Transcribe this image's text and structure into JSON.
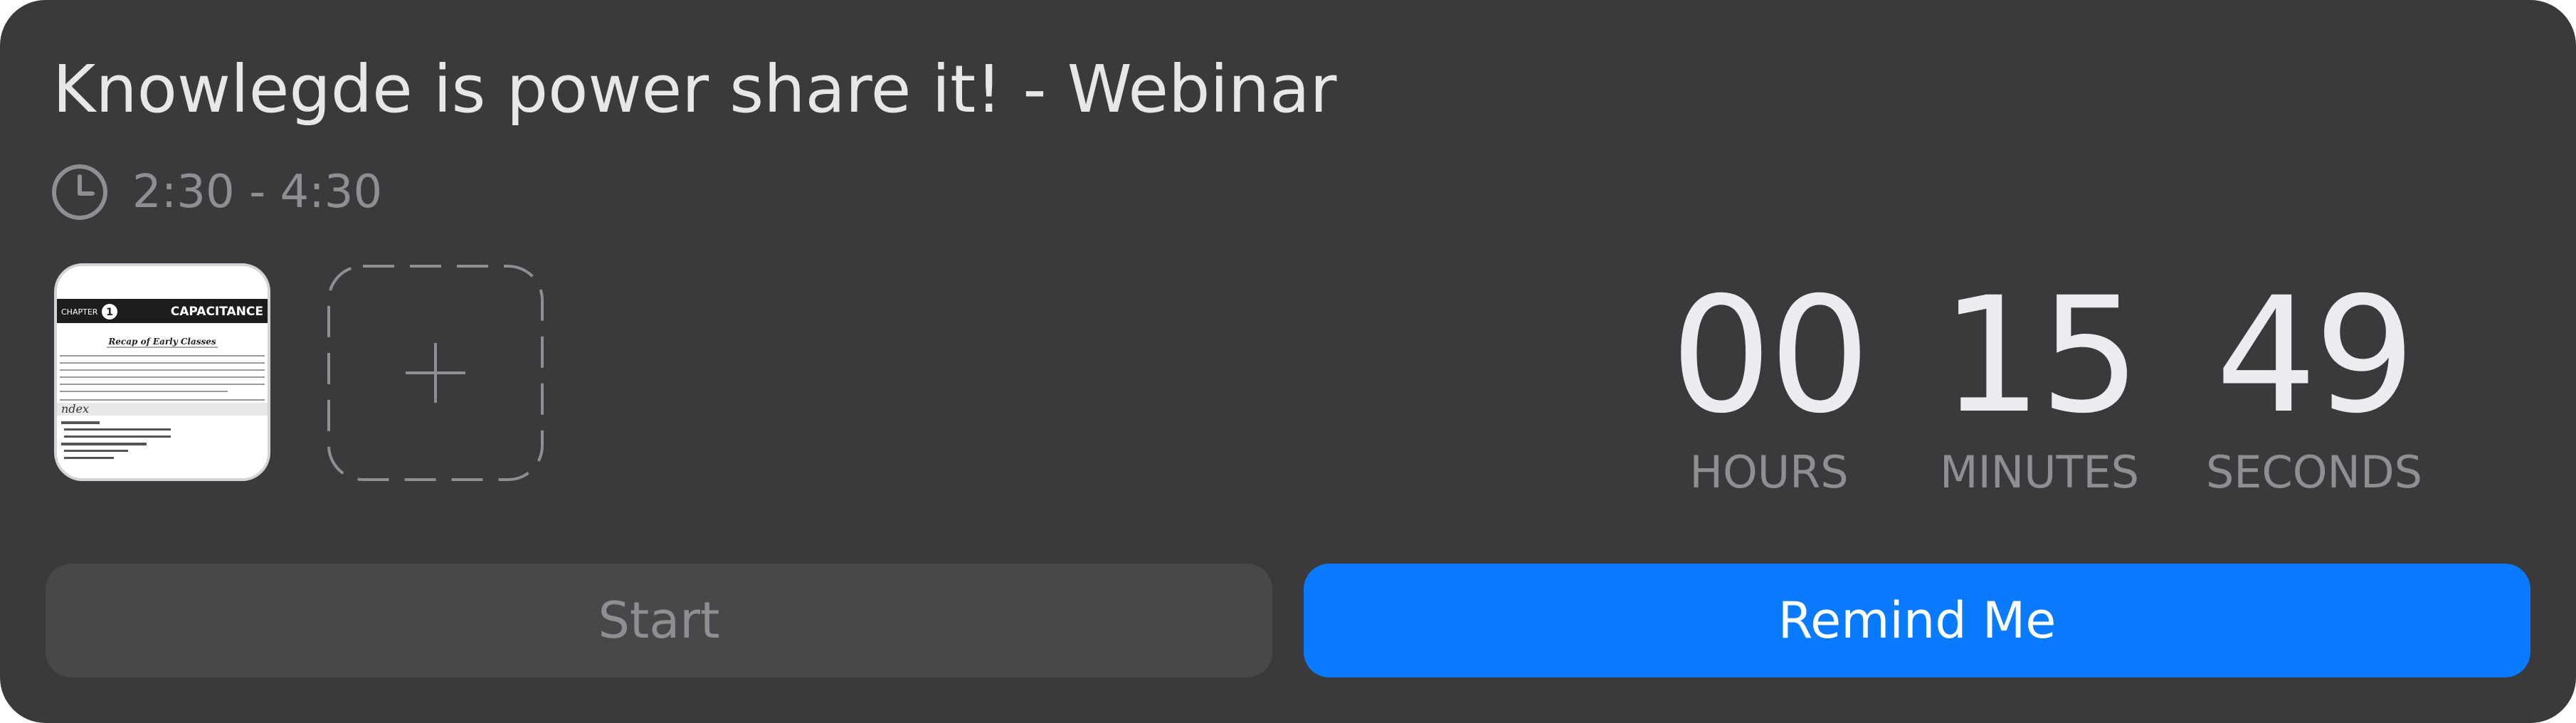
{
  "event": {
    "title": "Knowlegde is power share it! - Webinar",
    "time_range": "2:30 - 4:30"
  },
  "icons": {
    "clock": "clock-icon",
    "add": "plus-icon"
  },
  "attachment": {
    "chapter_label": "CHAPTER",
    "chapter_number": "1",
    "chapter_title": "CAPACITANCE",
    "heading": "Recap of Early Classes",
    "index_label": "ndex"
  },
  "countdown": {
    "hours": "00",
    "minutes": "15",
    "seconds": "49",
    "hours_label": "HOURS",
    "minutes_label": "MINUTES",
    "seconds_label": "SECONDS"
  },
  "actions": {
    "start_label": "Start",
    "remind_label": "Remind Me"
  },
  "colors": {
    "card_background": "#3a3a3c",
    "primary": "#0a7aff",
    "disabled_button": "#48484a",
    "muted_text": "#8e8e93"
  }
}
